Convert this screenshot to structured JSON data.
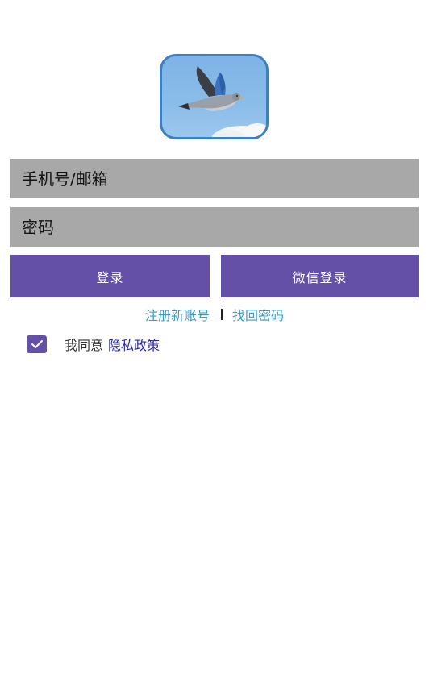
{
  "app": {
    "logo_icon": "flying-bird-icon"
  },
  "form": {
    "account_placeholder": "手机号/邮箱",
    "password_placeholder": "密码"
  },
  "buttons": {
    "login_label": "登录",
    "wechat_login_label": "微信登录"
  },
  "links": {
    "register_label": "注册新账号",
    "separator": "|",
    "forgot_password_label": "找回密码"
  },
  "agreement": {
    "checked": true,
    "prefix_text": "我同意",
    "policy_link_label": "隐私政策"
  },
  "colors": {
    "primary": "#6550a8",
    "input_background": "#a8a8a8",
    "link": "#3a9bc7",
    "policy_link": "#2a2aa8"
  }
}
